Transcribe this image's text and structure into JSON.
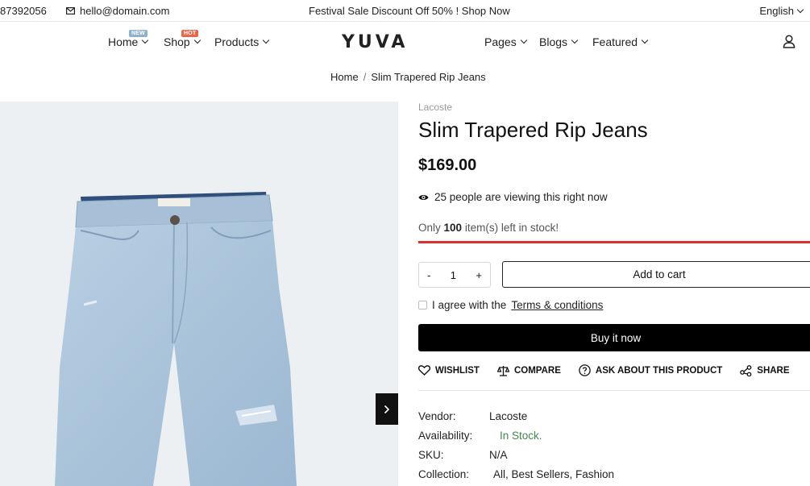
{
  "topbar": {
    "phone": "87392056",
    "email": "hello@domain.com",
    "promo": "Festival Sale Discount Off 50% ! Shop Now",
    "language": "English"
  },
  "nav": {
    "logo": "YUVA",
    "items": [
      {
        "label": "Home",
        "badge": "NEW"
      },
      {
        "label": "Shop",
        "badge": "HOT"
      },
      {
        "label": "Products",
        "badge": ""
      },
      {
        "label": "Pages",
        "badge": ""
      },
      {
        "label": "Blogs",
        "badge": ""
      },
      {
        "label": "Featured",
        "badge": ""
      }
    ]
  },
  "breadcrumb": {
    "home": "Home",
    "separator": "/",
    "current": "Slim Trapered Rip Jeans"
  },
  "product": {
    "vendor_label": "Lacoste",
    "title": "Slim Trapered Rip Jeans",
    "price": "$169.00",
    "viewing": "25 people are viewing this right now",
    "stock_prefix": "Only",
    "stock_count": "100",
    "stock_suffix": "item(s) left in stock!",
    "stock_fill_fraction": 1.0,
    "quantity": "1",
    "qty_minus": "-",
    "qty_plus": "+",
    "add_to_cart": "Add to cart",
    "agree_text": "I agree with the",
    "terms_link": "Terms & conditions",
    "buy_now": "Buy it now"
  },
  "actions": {
    "wishlist": "WISHLIST",
    "compare": "COMPARE",
    "ask": "ASK ABOUT THIS PRODUCT",
    "share": "SHARE"
  },
  "meta": {
    "vendor_key": "Vendor:",
    "vendor_value": "Lacoste",
    "availability_key": "Availability:",
    "availability_value": "In Stock.",
    "sku_key": "SKU:",
    "sku_value": "N/A",
    "collection_key": "Collection:",
    "collection_value": "All, Best Sellers, Fashion"
  },
  "colors": {
    "accent": "#e0302c",
    "in_stock": "#3f8a4b",
    "badge_new": "#8fb1c9",
    "badge_hot": "#e8674a"
  }
}
